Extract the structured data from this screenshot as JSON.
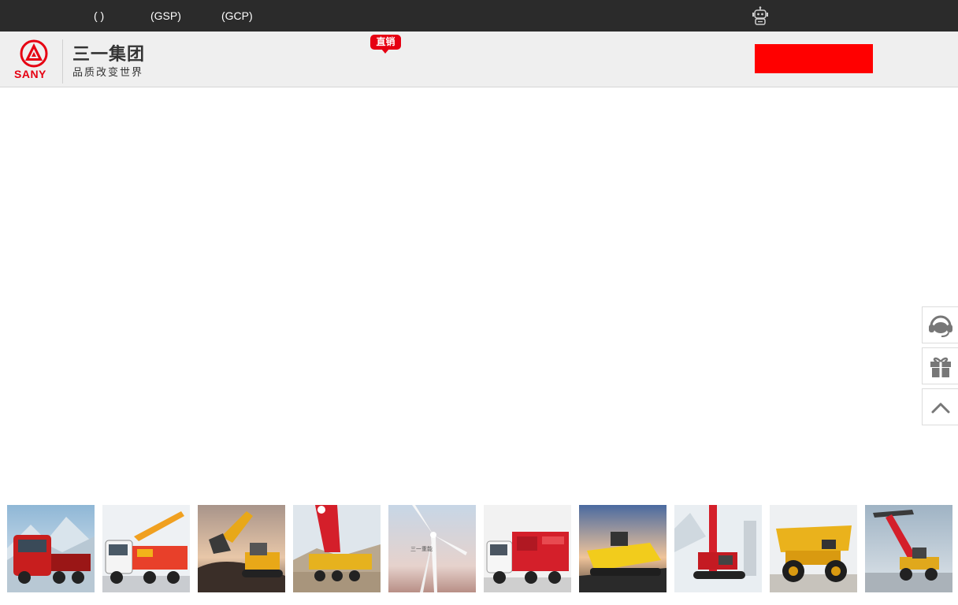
{
  "top_bar": {
    "links": [
      "( )",
      "(GSP)",
      "(GCP)"
    ],
    "robot_icon": "robot-icon"
  },
  "header": {
    "logo_text": "SANY",
    "brand_name": "三一集团",
    "slogan": "品质改变世界",
    "badge": "直销",
    "accent_color": "#e60012",
    "button_color": "#ff0000"
  },
  "side_tools": {
    "icons": [
      "customer-service-icon",
      "gift-icon",
      "back-to-top-icon"
    ]
  },
  "product_thumbnails": [
    "truck-tractor-image",
    "concrete-pump-truck-image",
    "excavator-image",
    "crane-image",
    "wind-turbine-image",
    "fire-truck-image",
    "paver-image",
    "rotary-drilling-rig-image",
    "mining-dump-truck-image",
    "reach-stacker-image"
  ]
}
